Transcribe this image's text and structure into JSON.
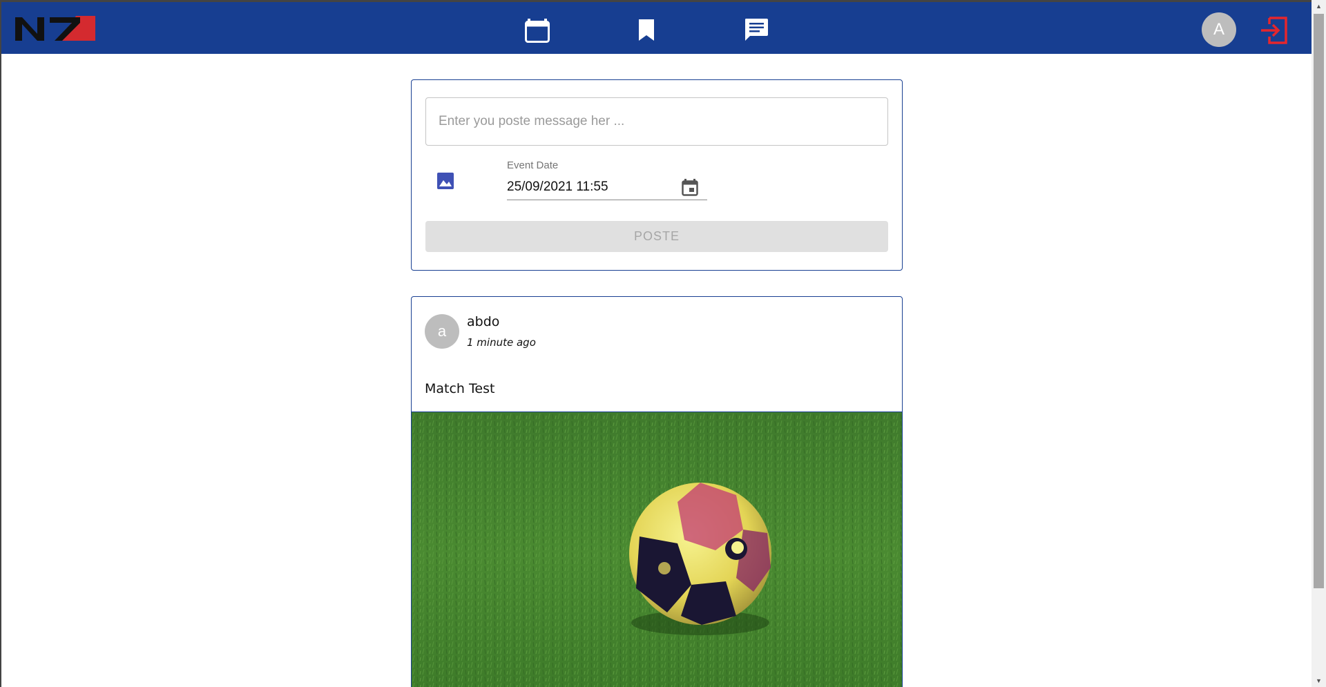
{
  "navbar": {
    "logo_text": "N7",
    "icons": [
      "calendar-icon",
      "bookmark-icon",
      "chat-icon"
    ],
    "user_initial": "A",
    "logout_icon": "logout-icon",
    "background_color": "#173e91",
    "logout_color": "#e5262d"
  },
  "composer": {
    "message_placeholder": "Enter you poste message her ...",
    "message_value": "",
    "image_icon": "image-icon",
    "event_date_label": "Event Date",
    "event_date_value": "25/09/2021 11:55",
    "date_picker_icon": "calendar-icon",
    "submit_label": "POSTE"
  },
  "posts": [
    {
      "author_initial": "a",
      "author": "abdo",
      "time_ago": "1 minute ago",
      "text": "Match Test",
      "image_description": "soccer-ball-on-grass"
    }
  ],
  "colors": {
    "accent": "#173e91",
    "avatar_gray": "#bdbdbd",
    "disabled_button": "#e0e0e0"
  }
}
